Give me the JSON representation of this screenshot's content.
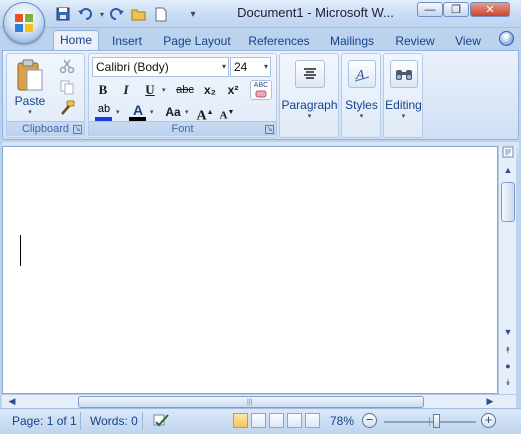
{
  "window": {
    "title": "Document1 - Microsoft W...",
    "minimize_label": "—",
    "maximize_label": "❐",
    "close_label": "✕"
  },
  "tabs": [
    {
      "label": "Home",
      "active": true
    },
    {
      "label": "Insert",
      "active": false
    },
    {
      "label": "Page Layout",
      "active": false
    },
    {
      "label": "References",
      "active": false
    },
    {
      "label": "Mailings",
      "active": false
    },
    {
      "label": "Review",
      "active": false
    },
    {
      "label": "View",
      "active": false
    }
  ],
  "help_label": "?",
  "clipboard": {
    "paste_label": "Paste",
    "group_label": "Clipboard"
  },
  "font": {
    "font_name": "Calibri (Body)",
    "font_size": "24",
    "group_label": "Font",
    "bold": "B",
    "italic": "I",
    "underline": "U",
    "strikethrough": "abc",
    "subscript": "x₂",
    "superscript": "x²",
    "case_label": "Aa",
    "grow": "A",
    "shrink": "A",
    "highlight_text": "ab",
    "font_color_text": "A",
    "highlight_color": "#1a3fe0",
    "font_color": "#000000",
    "clear_text": "ABC"
  },
  "paragraph": {
    "label": "Paragraph"
  },
  "styles": {
    "label": "Styles"
  },
  "editing": {
    "label": "Editing"
  },
  "status": {
    "page": "Page: 1 of 1",
    "words": "Words: 0",
    "zoom": "78%",
    "zoom_fraction": 0.58
  }
}
